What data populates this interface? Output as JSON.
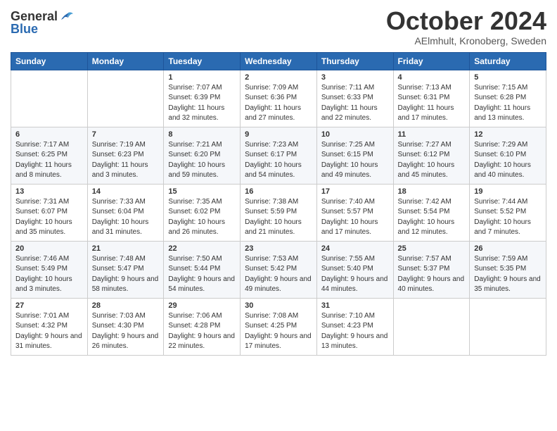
{
  "header": {
    "logo_general": "General",
    "logo_blue": "Blue",
    "month_title": "October 2024",
    "subtitle": "AElmhult, Kronoberg, Sweden"
  },
  "days_of_week": [
    "Sunday",
    "Monday",
    "Tuesday",
    "Wednesday",
    "Thursday",
    "Friday",
    "Saturday"
  ],
  "weeks": [
    [
      {
        "day": "",
        "info": ""
      },
      {
        "day": "",
        "info": ""
      },
      {
        "day": "1",
        "info": "Sunrise: 7:07 AM\nSunset: 6:39 PM\nDaylight: 11 hours and 32 minutes."
      },
      {
        "day": "2",
        "info": "Sunrise: 7:09 AM\nSunset: 6:36 PM\nDaylight: 11 hours and 27 minutes."
      },
      {
        "day": "3",
        "info": "Sunrise: 7:11 AM\nSunset: 6:33 PM\nDaylight: 11 hours and 22 minutes."
      },
      {
        "day": "4",
        "info": "Sunrise: 7:13 AM\nSunset: 6:31 PM\nDaylight: 11 hours and 17 minutes."
      },
      {
        "day": "5",
        "info": "Sunrise: 7:15 AM\nSunset: 6:28 PM\nDaylight: 11 hours and 13 minutes."
      }
    ],
    [
      {
        "day": "6",
        "info": "Sunrise: 7:17 AM\nSunset: 6:25 PM\nDaylight: 11 hours and 8 minutes."
      },
      {
        "day": "7",
        "info": "Sunrise: 7:19 AM\nSunset: 6:23 PM\nDaylight: 11 hours and 3 minutes."
      },
      {
        "day": "8",
        "info": "Sunrise: 7:21 AM\nSunset: 6:20 PM\nDaylight: 10 hours and 59 minutes."
      },
      {
        "day": "9",
        "info": "Sunrise: 7:23 AM\nSunset: 6:17 PM\nDaylight: 10 hours and 54 minutes."
      },
      {
        "day": "10",
        "info": "Sunrise: 7:25 AM\nSunset: 6:15 PM\nDaylight: 10 hours and 49 minutes."
      },
      {
        "day": "11",
        "info": "Sunrise: 7:27 AM\nSunset: 6:12 PM\nDaylight: 10 hours and 45 minutes."
      },
      {
        "day": "12",
        "info": "Sunrise: 7:29 AM\nSunset: 6:10 PM\nDaylight: 10 hours and 40 minutes."
      }
    ],
    [
      {
        "day": "13",
        "info": "Sunrise: 7:31 AM\nSunset: 6:07 PM\nDaylight: 10 hours and 35 minutes."
      },
      {
        "day": "14",
        "info": "Sunrise: 7:33 AM\nSunset: 6:04 PM\nDaylight: 10 hours and 31 minutes."
      },
      {
        "day": "15",
        "info": "Sunrise: 7:35 AM\nSunset: 6:02 PM\nDaylight: 10 hours and 26 minutes."
      },
      {
        "day": "16",
        "info": "Sunrise: 7:38 AM\nSunset: 5:59 PM\nDaylight: 10 hours and 21 minutes."
      },
      {
        "day": "17",
        "info": "Sunrise: 7:40 AM\nSunset: 5:57 PM\nDaylight: 10 hours and 17 minutes."
      },
      {
        "day": "18",
        "info": "Sunrise: 7:42 AM\nSunset: 5:54 PM\nDaylight: 10 hours and 12 minutes."
      },
      {
        "day": "19",
        "info": "Sunrise: 7:44 AM\nSunset: 5:52 PM\nDaylight: 10 hours and 7 minutes."
      }
    ],
    [
      {
        "day": "20",
        "info": "Sunrise: 7:46 AM\nSunset: 5:49 PM\nDaylight: 10 hours and 3 minutes."
      },
      {
        "day": "21",
        "info": "Sunrise: 7:48 AM\nSunset: 5:47 PM\nDaylight: 9 hours and 58 minutes."
      },
      {
        "day": "22",
        "info": "Sunrise: 7:50 AM\nSunset: 5:44 PM\nDaylight: 9 hours and 54 minutes."
      },
      {
        "day": "23",
        "info": "Sunrise: 7:53 AM\nSunset: 5:42 PM\nDaylight: 9 hours and 49 minutes."
      },
      {
        "day": "24",
        "info": "Sunrise: 7:55 AM\nSunset: 5:40 PM\nDaylight: 9 hours and 44 minutes."
      },
      {
        "day": "25",
        "info": "Sunrise: 7:57 AM\nSunset: 5:37 PM\nDaylight: 9 hours and 40 minutes."
      },
      {
        "day": "26",
        "info": "Sunrise: 7:59 AM\nSunset: 5:35 PM\nDaylight: 9 hours and 35 minutes."
      }
    ],
    [
      {
        "day": "27",
        "info": "Sunrise: 7:01 AM\nSunset: 4:32 PM\nDaylight: 9 hours and 31 minutes."
      },
      {
        "day": "28",
        "info": "Sunrise: 7:03 AM\nSunset: 4:30 PM\nDaylight: 9 hours and 26 minutes."
      },
      {
        "day": "29",
        "info": "Sunrise: 7:06 AM\nSunset: 4:28 PM\nDaylight: 9 hours and 22 minutes."
      },
      {
        "day": "30",
        "info": "Sunrise: 7:08 AM\nSunset: 4:25 PM\nDaylight: 9 hours and 17 minutes."
      },
      {
        "day": "31",
        "info": "Sunrise: 7:10 AM\nSunset: 4:23 PM\nDaylight: 9 hours and 13 minutes."
      },
      {
        "day": "",
        "info": ""
      },
      {
        "day": "",
        "info": ""
      }
    ]
  ]
}
